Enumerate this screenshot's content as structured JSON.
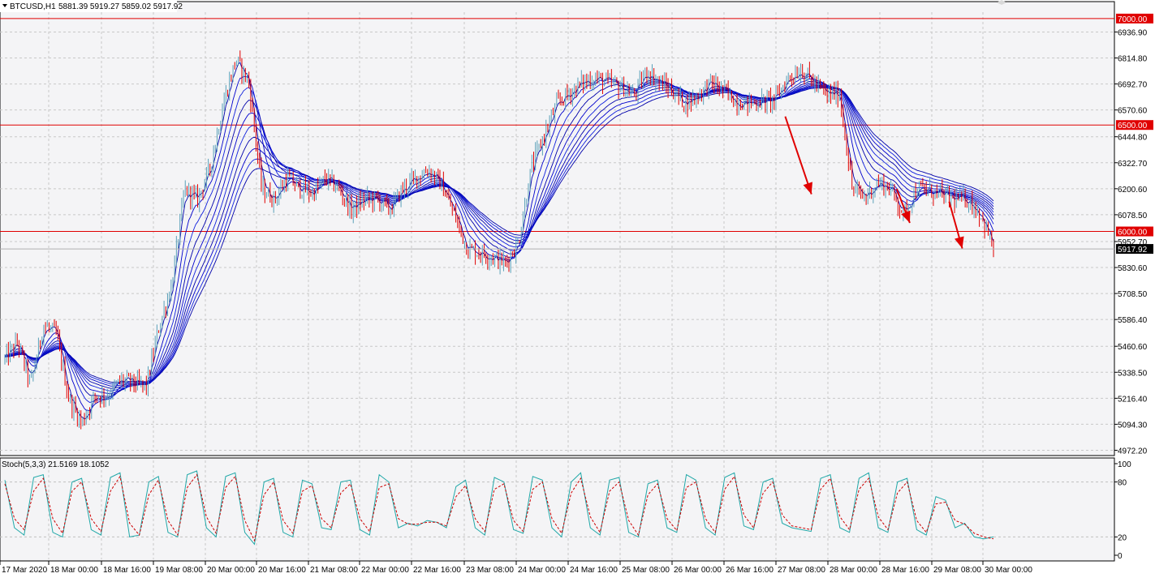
{
  "chart_data": [
    {
      "type": "candlestick",
      "symbol_header": "BTCUSD,H1",
      "ohlc_header": "5881.39 5919.27 5859.02 5917.92",
      "current_price": 5917.92,
      "current_price_label": "5917.92",
      "y_ticks": [
        "6936.90",
        "6814.80",
        "6692.70",
        "6570.60",
        "6444.80",
        "6322.70",
        "6200.60",
        "6078.50",
        "5952.70",
        "5830.60",
        "5708.50",
        "5586.40",
        "5460.60",
        "5338.50",
        "5216.40",
        "5094.30",
        "4972.20"
      ],
      "ylim": [
        4955,
        7030
      ],
      "horizontal_levels": [
        {
          "value": 7000,
          "label": "7000.00",
          "color": "#e00000"
        },
        {
          "value": 6500,
          "label": "6500.00",
          "color": "#e00000"
        },
        {
          "value": 6000,
          "label": "6000.00",
          "color": "#e00000"
        }
      ],
      "x_ticks": [
        "17 Mar 2020",
        "18 Mar 00:00",
        "18 Mar 16:00",
        "19 Mar 08:00",
        "20 Mar 00:00",
        "20 Mar 16:00",
        "21 Mar 08:00",
        "22 Mar 00:00",
        "22 Mar 16:00",
        "23 Mar 08:00",
        "24 Mar 00:00",
        "24 Mar 16:00",
        "25 Mar 08:00",
        "26 Mar 00:00",
        "26 Mar 16:00",
        "27 Mar 08:00",
        "28 Mar 00:00",
        "28 Mar 16:00",
        "29 Mar 08:00",
        "30 Mar 00:00"
      ],
      "price_path": [
        5400,
        5480,
        5280,
        5560,
        5520,
        5210,
        5100,
        5230,
        5230,
        5300,
        5290,
        5270,
        5550,
        5750,
        6200,
        6150,
        6300,
        6600,
        6810,
        6700,
        6200,
        6150,
        6250,
        6200,
        6180,
        6250,
        6200,
        6100,
        6150,
        6150,
        6100,
        6200,
        6250,
        6290,
        6220,
        6080,
        5920,
        5900,
        5880,
        5850,
        5950,
        6300,
        6450,
        6600,
        6650,
        6700,
        6720,
        6700,
        6680,
        6640,
        6750,
        6700,
        6660,
        6600,
        6640,
        6700,
        6660,
        6610,
        6600,
        6610,
        6620,
        6720,
        6760,
        6700,
        6640,
        6650,
        6200,
        6160,
        6230,
        6200,
        6080,
        6200,
        6190,
        6170,
        6150,
        6150,
        6080,
        5920
      ],
      "moving_average_ribbon": {
        "colors": [
          "#0000aa",
          "#0000cc",
          "#1020dd"
        ],
        "count": 10
      },
      "annotations": [
        {
          "type": "arrow",
          "color": "#e00000",
          "from": [
            "26 Mar 22:00",
            6540
          ],
          "to": [
            "27 Mar 06:00",
            6175
          ]
        },
        {
          "type": "arrow",
          "color": "#e00000",
          "from": [
            "28 Mar 08:00",
            6200
          ],
          "to": [
            "28 Mar 12:00",
            6040
          ]
        },
        {
          "type": "arrow",
          "color": "#e00000",
          "from": [
            "29 Mar 00:00",
            6140
          ],
          "to": [
            "29 Mar 04:00",
            5920
          ]
        }
      ],
      "colors": {
        "bull": "#5aa0b8",
        "bear": "#e00000",
        "grid": "#c8c8c8"
      }
    },
    {
      "type": "line",
      "title": "Stoch(5,3,3) 21.5169 18.1052",
      "y_ticks": [
        "100",
        "80",
        "20",
        "0"
      ],
      "ylim": [
        0,
        100
      ],
      "series": [
        {
          "name": "main",
          "color": "#20a8a8",
          "style": "solid",
          "values": [
            82,
            30,
            22,
            85,
            88,
            25,
            20,
            80,
            84,
            28,
            22,
            85,
            90,
            20,
            22,
            80,
            86,
            25,
            20,
            88,
            92,
            30,
            20,
            86,
            90,
            25,
            12,
            80,
            84,
            25,
            20,
            82,
            78,
            30,
            28,
            80,
            82,
            28,
            22,
            88,
            80,
            30,
            35,
            32,
            38,
            36,
            30,
            75,
            82,
            30,
            22,
            85,
            80,
            28,
            24,
            86,
            82,
            30,
            20,
            80,
            90,
            30,
            22,
            82,
            85,
            25,
            20,
            78,
            82,
            30,
            25,
            88,
            82,
            30,
            22,
            85,
            90,
            32,
            28,
            80,
            84,
            35,
            30,
            28,
            26,
            84,
            88,
            30,
            25,
            84,
            90,
            30,
            25,
            80,
            84,
            28,
            22,
            64,
            60,
            30,
            35,
            20,
            18,
            20
          ]
        },
        {
          "name": "signal",
          "color": "#cc0000",
          "style": "dashed",
          "values": [
            78,
            40,
            28,
            70,
            84,
            40,
            24,
            70,
            80,
            40,
            26,
            70,
            86,
            35,
            22,
            66,
            82,
            38,
            22,
            74,
            88,
            42,
            24,
            74,
            86,
            38,
            16,
            66,
            80,
            38,
            24,
            70,
            76,
            40,
            30,
            68,
            78,
            40,
            26,
            74,
            78,
            40,
            34,
            34,
            36,
            36,
            32,
            64,
            76,
            40,
            26,
            72,
            78,
            38,
            26,
            72,
            80,
            40,
            24,
            68,
            84,
            42,
            25,
            70,
            80,
            38,
            22,
            66,
            78,
            40,
            27,
            74,
            80,
            40,
            25,
            72,
            86,
            44,
            30,
            68,
            80,
            44,
            32,
            30,
            28,
            72,
            84,
            42,
            28,
            72,
            84,
            42,
            28,
            68,
            80,
            38,
            25,
            56,
            58,
            38,
            34,
            24,
            20,
            18
          ]
        }
      ]
    }
  ]
}
